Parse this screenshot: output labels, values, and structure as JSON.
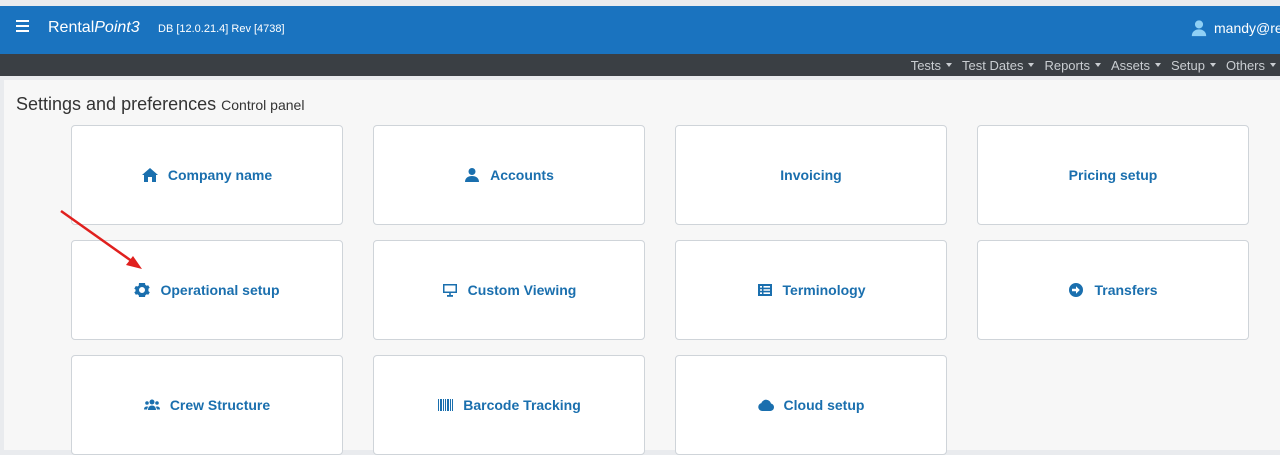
{
  "header": {
    "brand_prefix": "Rental",
    "brand_italic": "Point3",
    "db_info": "DB [12.0.21.4]  Rev [4738]",
    "user": "mandy@re"
  },
  "menu": [
    "Tests",
    "Test Dates",
    "Reports",
    "Assets",
    "Setup",
    "Others"
  ],
  "page": {
    "title": "Settings and preferences",
    "subtitle": "Control panel"
  },
  "tiles": [
    {
      "label": "Company name",
      "icon": "home-icon"
    },
    {
      "label": "Accounts",
      "icon": "user-icon"
    },
    {
      "label": "Invoicing",
      "icon": ""
    },
    {
      "label": "Pricing setup",
      "icon": ""
    },
    {
      "label": "Operational setup",
      "icon": "gear-icon"
    },
    {
      "label": "Custom Viewing",
      "icon": "monitor-icon"
    },
    {
      "label": "Terminology",
      "icon": "list-icon"
    },
    {
      "label": "Transfers",
      "icon": "arrow-circle-icon"
    },
    {
      "label": "Crew Structure",
      "icon": "users-icon"
    },
    {
      "label": "Barcode Tracking",
      "icon": "barcode-icon"
    },
    {
      "label": "Cloud setup",
      "icon": "cloud-icon"
    }
  ],
  "colors": {
    "header_bg": "#1a73bf",
    "menubar_bg": "#3a3f44",
    "tile_text": "#1a6fae",
    "annotation_arrow": "#e0201e"
  }
}
